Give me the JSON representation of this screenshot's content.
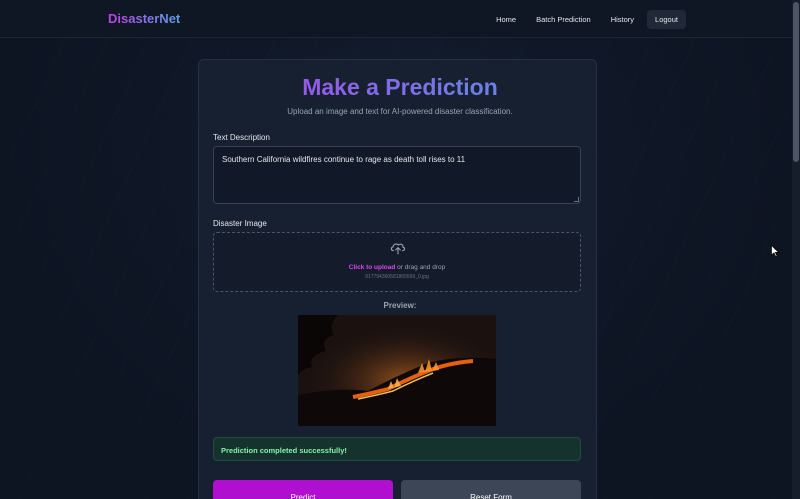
{
  "brand": "DisasterNet",
  "nav": {
    "home": "Home",
    "batch": "Batch Prediction",
    "history": "History",
    "logout": "Logout"
  },
  "page": {
    "title": "Make a Prediction",
    "subtitle": "Upload an image and text for AI-powered disaster classification."
  },
  "form": {
    "text_label": "Text Description",
    "text_value": "Southern California wildfires continue to rage as death toll rises to 11",
    "image_label": "Disaster Image",
    "upload_cta": "Click to upload",
    "upload_rest": " or drag and drop",
    "filename": "917794360581865569_0.jpg",
    "preview_label": "Preview:"
  },
  "status": {
    "message": "Prediction completed successfully!"
  },
  "buttons": {
    "predict": "Predict",
    "reset": "Reset Form"
  },
  "icons": {
    "upload": "upload-cloud-icon",
    "cursor": "mouse-pointer-icon"
  },
  "colors": {
    "accent": "#b10fcf",
    "success": "#86efac",
    "background": "#0f1624"
  }
}
